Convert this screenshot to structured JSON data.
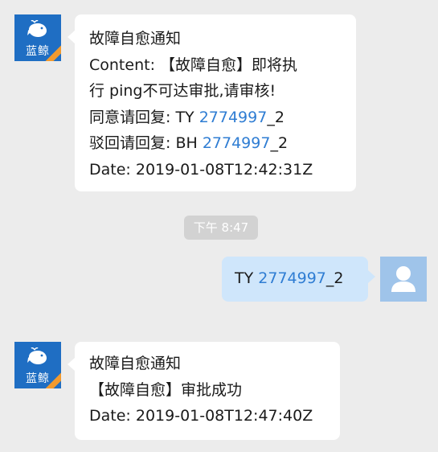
{
  "bot": {
    "name_logo": "蓝鲸",
    "brand_color": "#1f6ec3",
    "accent_color": "#f29a2e"
  },
  "messages": [
    {
      "lines": [
        "故障自愈通知",
        "Content: 【故障自愈】即将执",
        "行 ping不可达审批,请审核!"
      ],
      "approve_prefix": "同意请回复: TY ",
      "approve_id": "2774997",
      "approve_suffix": "_2",
      "reject_prefix": "驳回请回复: BH ",
      "reject_id": "2774997",
      "reject_suffix": "_2",
      "date": "Date: 2019-01-08T12:42:31Z"
    },
    {
      "lines": [
        "故障自愈通知",
        "【故障自愈】审批成功",
        "Date: 2019-01-08T12:47:40Z"
      ]
    }
  ],
  "timestamp": "下午 8:47",
  "reply": {
    "prefix": "TY ",
    "id": "2774997",
    "suffix": "_2"
  },
  "icons": {
    "bot_avatar": "whale-logo-icon",
    "user_avatar": "user-silhouette-icon"
  }
}
